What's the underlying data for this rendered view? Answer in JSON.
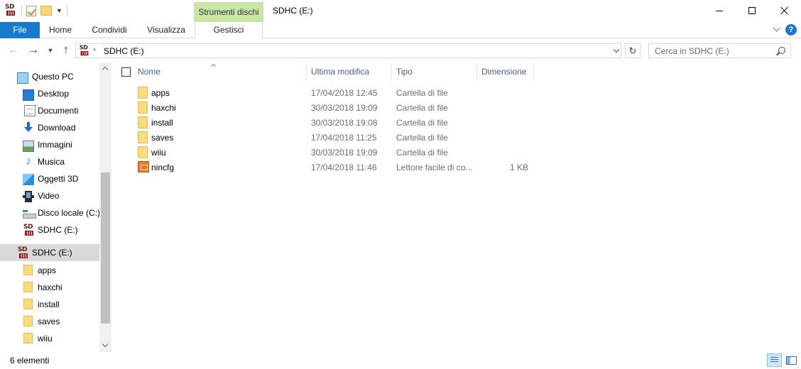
{
  "window": {
    "title": "SDHC (E:)",
    "contextual_tab": "Strumenti dischi"
  },
  "ribbon": {
    "tabs": [
      "File",
      "Home",
      "Condividi",
      "Visualizza",
      "Gestisci"
    ],
    "help_label": "?"
  },
  "address": {
    "path": "SDHC (E:)",
    "separator": "›"
  },
  "search": {
    "placeholder": "Cerca in SDHC (E:)"
  },
  "nav": {
    "items": [
      {
        "label": "Questo PC",
        "icon": "computer-icon"
      },
      {
        "label": "Desktop",
        "icon": "desktop-icon"
      },
      {
        "label": "Documenti",
        "icon": "documents-icon"
      },
      {
        "label": "Download",
        "icon": "download-icon"
      },
      {
        "label": "Immagini",
        "icon": "pictures-icon"
      },
      {
        "label": "Musica",
        "icon": "music-icon"
      },
      {
        "label": "Oggetti 3D",
        "icon": "3d-objects-icon"
      },
      {
        "label": "Video",
        "icon": "video-icon"
      },
      {
        "label": "Disco locale (C:)",
        "icon": "local-disk-icon"
      },
      {
        "label": "SDHC (E:)",
        "icon": "sd-card-icon"
      },
      {
        "label": "SDHC (E:)",
        "icon": "sd-card-icon",
        "selected": true
      },
      {
        "label": "apps",
        "icon": "folder-icon"
      },
      {
        "label": "haxchi",
        "icon": "folder-icon"
      },
      {
        "label": "install",
        "icon": "folder-icon"
      },
      {
        "label": "saves",
        "icon": "folder-icon"
      },
      {
        "label": "wiiu",
        "icon": "folder-icon"
      }
    ]
  },
  "columns": {
    "name": "Nome",
    "modified": "Ultima modifica",
    "type": "Tipo",
    "size": "Dimensione"
  },
  "files": [
    {
      "name": "apps",
      "modified": "17/04/2018 12:45",
      "type": "Cartella di file",
      "size": "",
      "icon": "folder-icon"
    },
    {
      "name": "haxchi",
      "modified": "30/03/2018 19:09",
      "type": "Cartella di file",
      "size": "",
      "icon": "folder-icon"
    },
    {
      "name": "install",
      "modified": "30/03/2018 19:08",
      "type": "Cartella di file",
      "size": "",
      "icon": "folder-icon"
    },
    {
      "name": "saves",
      "modified": "17/04/2018 11:25",
      "type": "Cartella di file",
      "size": "",
      "icon": "folder-icon"
    },
    {
      "name": "wiiu",
      "modified": "30/03/2018 19:09",
      "type": "Cartella di file",
      "size": "",
      "icon": "folder-icon"
    },
    {
      "name": "nincfg",
      "modified": "17/04/2018 11:46",
      "type": "Lettore facile di co...",
      "size": "1 KB",
      "icon": "config-file-icon"
    }
  ],
  "status": {
    "count": "6 elementi"
  },
  "colors": {
    "file_tab": "#1979ca",
    "contextual_tab": "#c8e6a4",
    "selection": "#d9d9d9"
  }
}
